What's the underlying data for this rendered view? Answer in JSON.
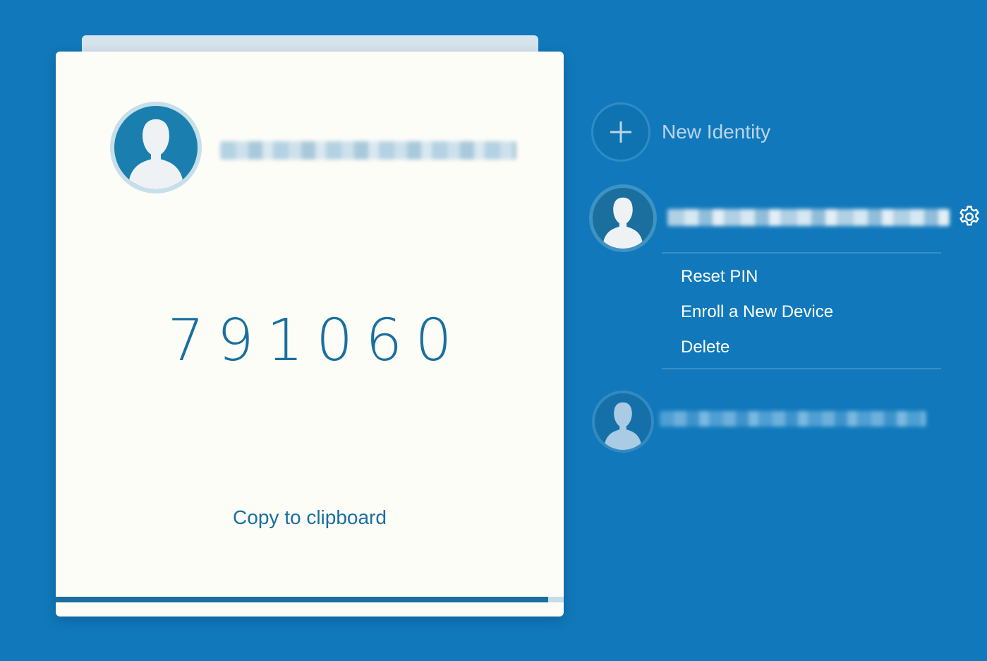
{
  "colors": {
    "background": "#1179bb",
    "card": "#fdfdf8",
    "accent": "#1a6f9e",
    "menu_text": "#ffffff"
  },
  "active_identity": {
    "name": "",
    "code": "791060",
    "copy_label": "Copy to clipboard",
    "timer_remaining_fraction": 0.97
  },
  "sidebar": {
    "new_identity_label": "New Identity",
    "identities": [
      {
        "name": "",
        "icon": "settings-gear-icon",
        "menu": [
          "Reset PIN",
          "Enroll a New Device",
          "Delete"
        ]
      },
      {
        "name": ""
      }
    ]
  }
}
